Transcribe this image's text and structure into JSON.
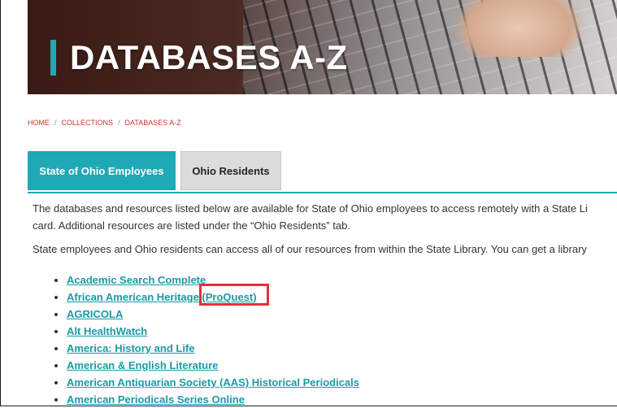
{
  "hero": {
    "title": "DATABASES A-Z"
  },
  "breadcrumb": [
    "HOME",
    "COLLECTIONS",
    "DATABASES A-Z"
  ],
  "tabs": [
    {
      "label": "State of Ohio Employees",
      "active": true
    },
    {
      "label": "Ohio Residents",
      "active": false
    }
  ],
  "content": {
    "para1_line1": "The databases and resources listed below are available for State of Ohio employees to access remotely with a State Li",
    "para1_line2": "card. Additional resources are listed under the “Ohio Residents” tab.",
    "para2": "State employees and Ohio residents can access all of our resources from within the State Library. You can get a library"
  },
  "databases": [
    "Academic Search Complete",
    "African American Heritage (ProQuest)",
    "AGRICOLA",
    "Alt HealthWatch",
    "America: History and Life",
    "American & English Literature",
    "American Antiquarian Society (AAS) Historical Periodicals",
    "American Periodicals Series Online"
  ],
  "colors": {
    "accent": "#1fa8b5",
    "link": "#1a9aa6",
    "breadcrumb": "#c0392b",
    "highlight": "#e5303a"
  }
}
